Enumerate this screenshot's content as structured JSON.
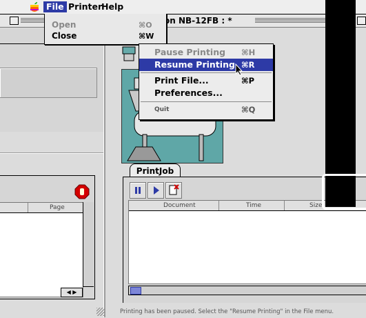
{
  "menubar": {
    "items": [
      {
        "label": "File",
        "active": true
      },
      {
        "label": "Printer",
        "active": false
      },
      {
        "label": "Help",
        "active": false
      }
    ]
  },
  "window": {
    "title": "on NB-12FB : *"
  },
  "file_menu": {
    "items": [
      {
        "label": "Open",
        "shortcut": "⌘O",
        "enabled": false
      },
      {
        "label": "Close",
        "shortcut": "⌘W",
        "enabled": true
      }
    ]
  },
  "printer_menu": {
    "items": [
      {
        "label": "Pause Printing",
        "shortcut": "⌘H",
        "state": "disabled"
      },
      {
        "label": "Resume Printing",
        "shortcut": "⌘R",
        "state": "selected"
      },
      {
        "label": "Print File...",
        "shortcut": "⌘P",
        "state": "enabled"
      },
      {
        "label": "Preferences...",
        "shortcut": "",
        "state": "enabled"
      },
      {
        "label": "Quit",
        "shortcut": "⌘Q",
        "state": "enabled"
      }
    ]
  },
  "printjob": {
    "tab_label": "PrintJob",
    "columns": [
      "Document",
      "Time",
      "Size"
    ]
  },
  "left_list": {
    "columns": [
      "",
      "Page"
    ]
  },
  "status_text": "Printing has been paused. Select the \"Resume Printing\" in the File menu.",
  "colors": {
    "highlight": "#2d3aa6",
    "stop_red": "#d40000"
  }
}
